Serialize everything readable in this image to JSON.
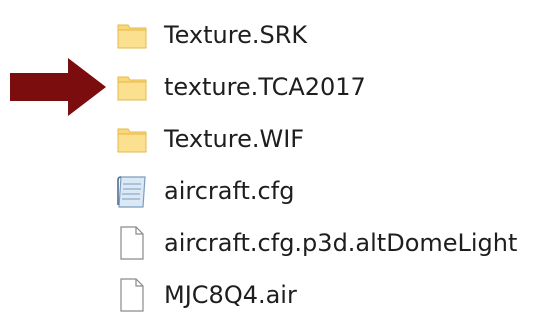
{
  "colors": {
    "arrow": "#7b0d0e",
    "folder": "#f9d977",
    "folder_edge": "#e7b84a",
    "text": "#1e1e1e"
  },
  "files": [
    {
      "name": "Texture.SRK",
      "icon": "folder-icon"
    },
    {
      "name": "texture.TCA2017",
      "icon": "folder-icon"
    },
    {
      "name": "Texture.WIF",
      "icon": "folder-icon"
    },
    {
      "name": "aircraft.cfg",
      "icon": "config-file-icon"
    },
    {
      "name": "aircraft.cfg.p3d.altDomeLight",
      "icon": "blank-file-icon"
    },
    {
      "name": "MJC8Q4.air",
      "icon": "blank-file-icon"
    }
  ]
}
